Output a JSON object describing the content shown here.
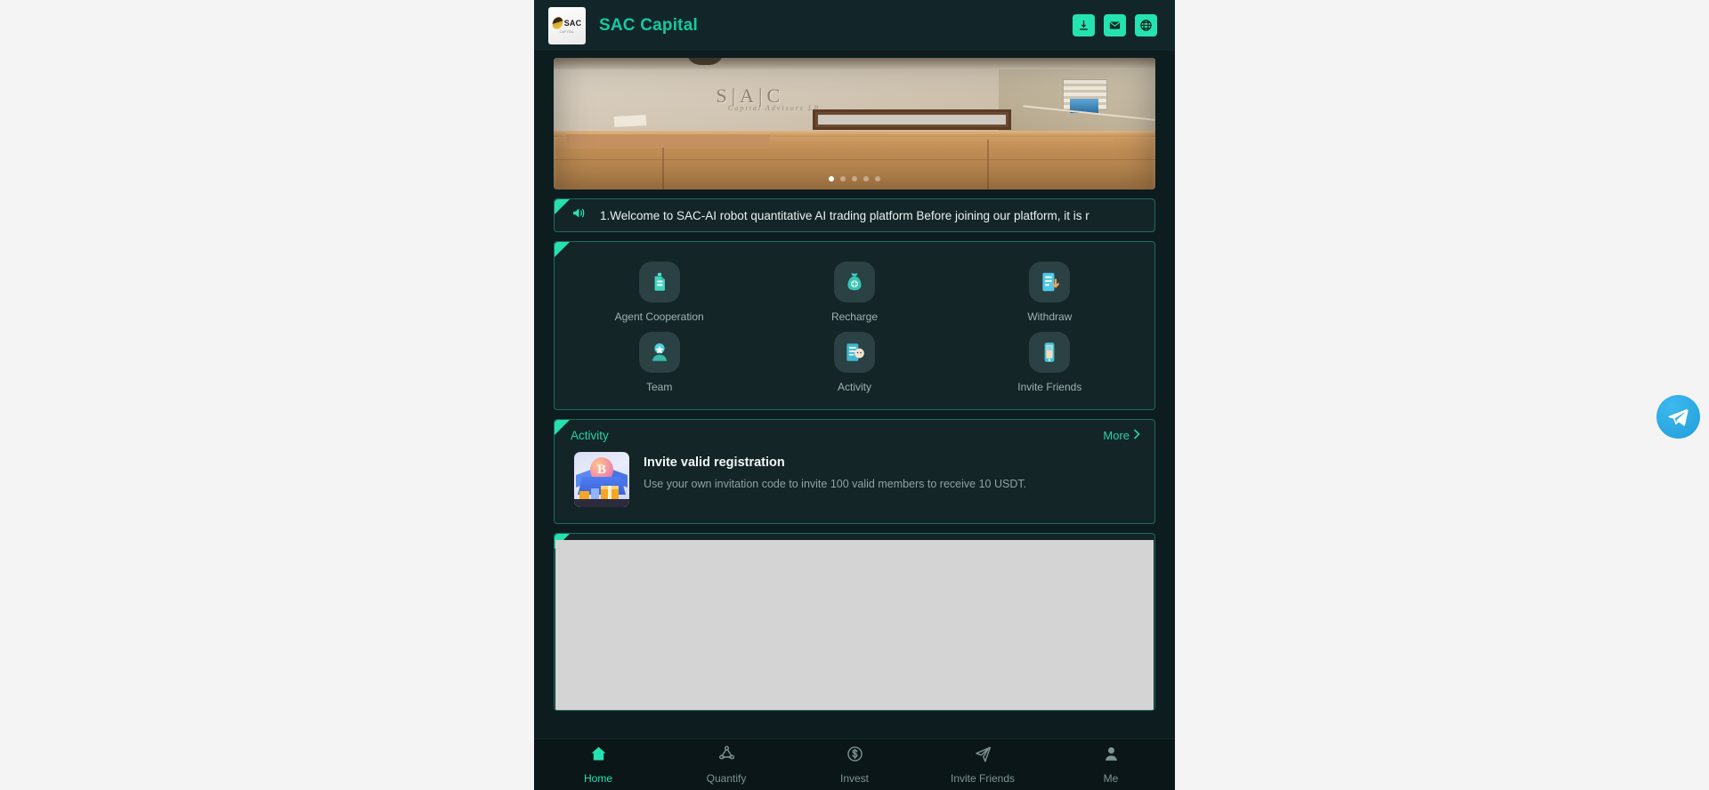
{
  "header": {
    "logo_text": "SAC",
    "logo_subtext": "CAPITAL",
    "title": "SAC Capital",
    "actions": [
      {
        "name": "download-icon",
        "label": "Download"
      },
      {
        "name": "mail-icon",
        "label": "Mail"
      },
      {
        "name": "globe-icon",
        "label": "Language"
      }
    ]
  },
  "banner": {
    "sign_text": "S|A|C",
    "sign_subtext": "Capital Advisors LP",
    "slide_count": 5,
    "active_slide": 1
  },
  "notice": {
    "icon": "megaphone-icon",
    "text": "1.Welcome to SAC-AI robot quantitative AI trading platform Before joining our platform, it is r"
  },
  "menu": {
    "items": [
      {
        "label": "Agent Cooperation",
        "icon": "agent-cooperation-icon"
      },
      {
        "label": "Recharge",
        "icon": "recharge-icon"
      },
      {
        "label": "Withdraw",
        "icon": "withdraw-icon"
      },
      {
        "label": "Team",
        "icon": "team-icon"
      },
      {
        "label": "Activity",
        "icon": "activity-icon"
      },
      {
        "label": "Invite Friends",
        "icon": "invite-friends-icon"
      }
    ]
  },
  "activity": {
    "title": "Activity",
    "more_label": "More",
    "items": [
      {
        "title": "Invite valid registration",
        "description": "Use your own invitation code to invite 100 valid members to receive 10 USDT.",
        "thumb_symbol": "B"
      }
    ]
  },
  "placeholder": {
    "content": ""
  },
  "tabbar": {
    "items": [
      {
        "label": "Home",
        "icon": "home-icon",
        "active": true
      },
      {
        "label": "Quantify",
        "icon": "quantify-icon",
        "active": false
      },
      {
        "label": "Invest",
        "icon": "invest-icon",
        "active": false
      },
      {
        "label": "Invite Friends",
        "icon": "invite-friends-icon",
        "active": false
      },
      {
        "label": "Me",
        "icon": "profile-icon",
        "active": false
      }
    ]
  },
  "fab": {
    "name": "telegram-button",
    "label": "Telegram"
  },
  "colors": {
    "accent": "#25e3b0",
    "accent_text": "#17c9a0",
    "card_bg": "#132527",
    "app_bg": "#0d1c1f",
    "header_bg": "#12262a",
    "tabbar_bg": "#0a1618",
    "telegram": "#229ed9"
  }
}
